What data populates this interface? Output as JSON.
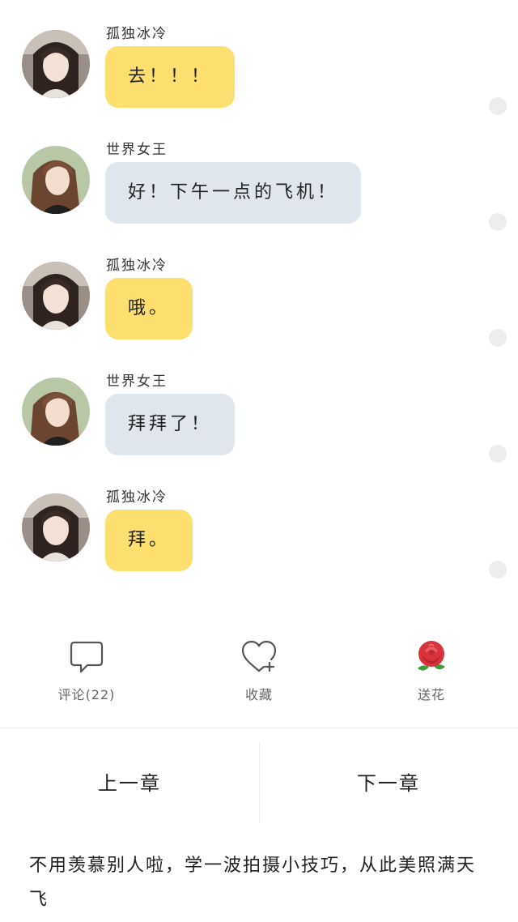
{
  "messages": [
    {
      "sender": "孤独冰冷",
      "text": "去！！！",
      "bubble": "yellow"
    },
    {
      "sender": "世界女王",
      "text": "好！下午一点的飞机！",
      "bubble": "grey"
    },
    {
      "sender": "孤独冰冷",
      "text": "哦。",
      "bubble": "yellow"
    },
    {
      "sender": "世界女王",
      "text": "拜拜了！",
      "bubble": "grey"
    },
    {
      "sender": "孤独冰冷",
      "text": "拜。",
      "bubble": "yellow"
    }
  ],
  "actions": {
    "comment_label": "评论(22)",
    "favorite_label": "收藏",
    "flower_label": "送花"
  },
  "nav": {
    "prev_label": "上一章",
    "next_label": "下一章"
  },
  "promo": {
    "text": "不用羡慕别人啦，学一波拍摄小技巧，从此美照满天飞"
  },
  "colors": {
    "bubble_yellow": "#fcdf6f",
    "bubble_grey": "#dfe6ed",
    "text": "#222222",
    "muted": "#666666"
  },
  "icons": {
    "comment": "speech-bubble-icon",
    "favorite": "heart-plus-icon",
    "flower": "rose-icon"
  }
}
